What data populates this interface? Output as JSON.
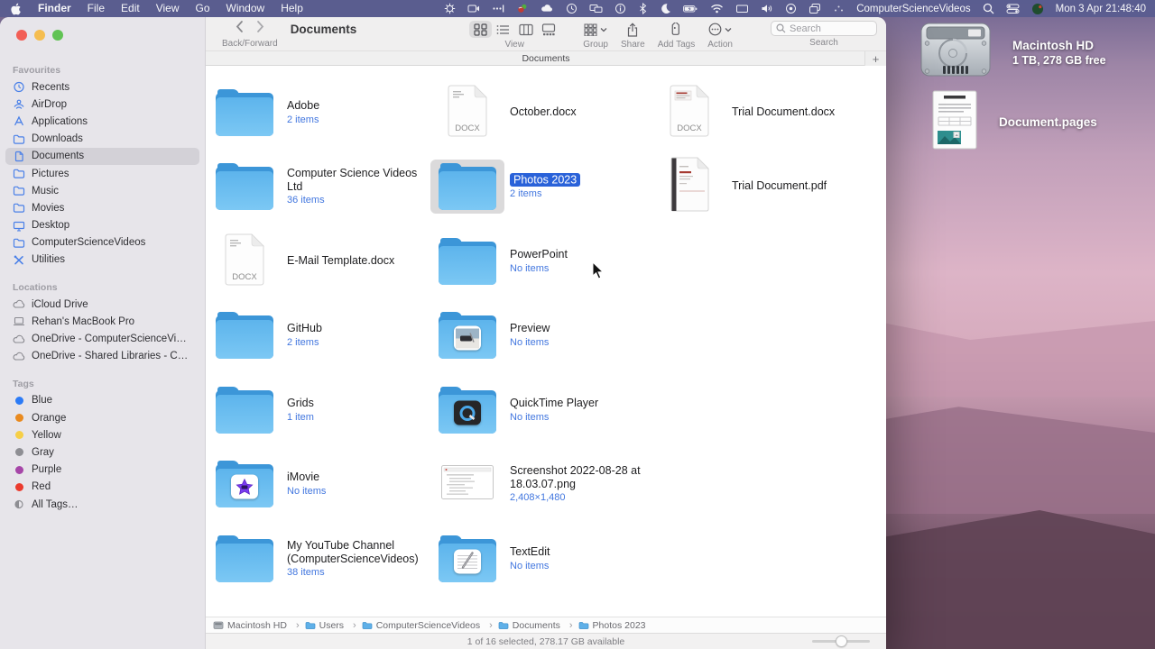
{
  "colors": {
    "accent": "#2a62d9",
    "sublabel_blue": "#4176df",
    "folder_blue": "#66bbf0",
    "menu_bar": "#5a5d8f",
    "selection_tile": "#dbdadb"
  },
  "menu_bar": {
    "items": [
      "Finder",
      "File",
      "Edit",
      "View",
      "Go",
      "Window",
      "Help"
    ],
    "status_text": "ComputerScienceVideos",
    "clock": "Mon 3 Apr 21:48:40"
  },
  "toolbar": {
    "back_forward_label": "Back/Forward",
    "title": "Documents",
    "view_label": "View",
    "group_label": "Group",
    "share_label": "Share",
    "add_tags_label": "Add Tags",
    "action_label": "Action",
    "search_label": "Search",
    "search_placeholder": "Search"
  },
  "tab_bar": {
    "tab": "Documents",
    "new_tab": "+"
  },
  "sidebar": {
    "sections": [
      {
        "title": "Favourites",
        "items": [
          {
            "label": "Recents"
          },
          {
            "label": "AirDrop"
          },
          {
            "label": "Applications"
          },
          {
            "label": "Downloads"
          },
          {
            "label": "Documents"
          },
          {
            "label": "Pictures"
          },
          {
            "label": "Music"
          },
          {
            "label": "Movies"
          },
          {
            "label": "Desktop"
          },
          {
            "label": "ComputerScienceVideos"
          },
          {
            "label": "Utilities"
          }
        ]
      },
      {
        "title": "Locations",
        "items": [
          {
            "label": "iCloud Drive"
          },
          {
            "label": "Rehan's MacBook Pro"
          },
          {
            "label": "OneDrive - ComputerScienceVideos"
          },
          {
            "label": "OneDrive - Shared Libraries - Comp…"
          }
        ]
      },
      {
        "title": "Tags",
        "items": [
          {
            "label": "Blue",
            "color": "#2c7bf6"
          },
          {
            "label": "Orange",
            "color": "#e98a1f"
          },
          {
            "label": "Yellow",
            "color": "#f6cf47"
          },
          {
            "label": "Gray",
            "color": "#8e8e93"
          },
          {
            "label": "Purple",
            "color": "#a646a8"
          },
          {
            "label": "Red",
            "color": "#eb3b2e"
          },
          {
            "label": "All Tags…",
            "color": ""
          }
        ]
      }
    ]
  },
  "grid": {
    "items": [
      {
        "name": "Adobe",
        "sub": "2 items"
      },
      {
        "name": "October.docx",
        "sub": ""
      },
      {
        "name": "Trial Document.docx",
        "sub": ""
      },
      {
        "name": "Computer Science Videos Ltd",
        "sub": "36 items"
      },
      {
        "name": "Photos 2023",
        "sub": "2 items"
      },
      {
        "name": "Trial Document.pdf",
        "sub": ""
      },
      {
        "name": "E-Mail Template.docx",
        "sub": ""
      },
      {
        "name": "PowerPoint",
        "sub": "No items"
      },
      {
        "name": "GitHub",
        "sub": "2 items"
      },
      {
        "name": "Preview",
        "sub": "No items"
      },
      {
        "name": "Grids",
        "sub": "1 item"
      },
      {
        "name": "QuickTime Player",
        "sub": "No items"
      },
      {
        "name": "iMovie",
        "sub": "No items"
      },
      {
        "name": "Screenshot 2022-08-28 at 18.03.07.png",
        "sub": "2,408×1,480"
      },
      {
        "name": "My YouTube Channel (ComputerScienceVideos)",
        "sub": "38 items"
      },
      {
        "name": "TextEdit",
        "sub": "No items"
      }
    ]
  },
  "path_bar": {
    "items": [
      {
        "label": "Macintosh HD"
      },
      {
        "label": "Users"
      },
      {
        "label": "ComputerScienceVideos"
      },
      {
        "label": "Documents"
      },
      {
        "label": "Photos 2023"
      }
    ]
  },
  "status_bar": {
    "text": "1 of 16 selected, 278.17 GB available"
  },
  "desktop": {
    "drive": {
      "name": "Macintosh HD",
      "info": "1 TB, 278 GB free"
    },
    "document": {
      "name": "Document.pages"
    }
  }
}
